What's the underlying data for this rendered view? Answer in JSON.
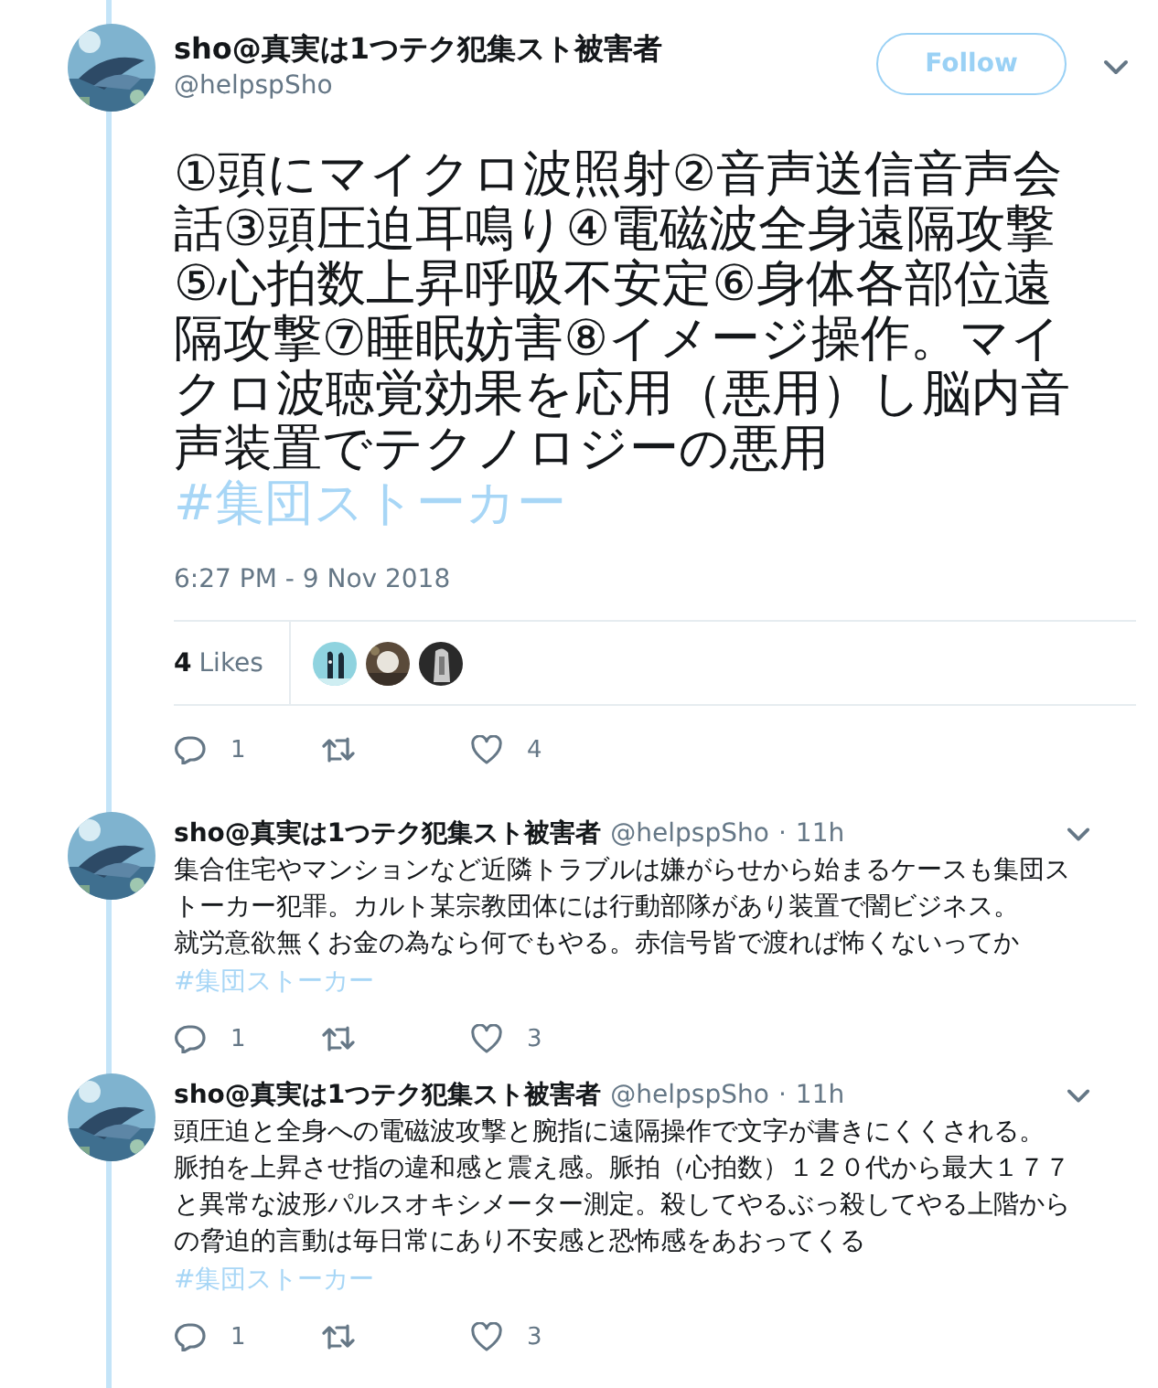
{
  "tweet": {
    "author": {
      "name": "sho@真実は1つテク犯集スト被害者",
      "handle": "@helpspSho"
    },
    "follow_button": "Follow",
    "text": "①頭にマイクロ波照射②音声送信音声会話③頭圧迫耳鳴り④電磁波全身遠隔攻撃⑤心拍数上昇呼吸不安定⑥身体各部位遠隔攻撃⑦睡眠妨害⑧イメージ操作。マイクロ波聴覚効果を応用（悪用）し脳内音声装置でテクノロジーの悪用",
    "hashtag": "#集団ストーカー",
    "timestamp": "6:27 PM - 9 Nov 2018",
    "likes": {
      "count": "4",
      "label": "Likes"
    },
    "actions": {
      "reply_count": "1",
      "like_count": "4"
    }
  },
  "replies": [
    {
      "name": "sho@真実は1つテク犯集スト被害者",
      "handle": "@helpspSho",
      "separator": "·",
      "time": "11h",
      "paragraphs": [
        "集合住宅やマンションなど近隣トラブルは嫌がらせから始まるケースも集団ストーカー犯罪。カルト某宗教団体には行動部隊があり装置で闇ビジネス。",
        "就労意欲無くお金の為なら何でもやる。赤信号皆で渡れば怖くないってか"
      ],
      "hashtag": "#集団ストーカー",
      "reply_count": "1",
      "like_count": "3"
    },
    {
      "name": "sho@真実は1つテク犯集スト被害者",
      "handle": "@helpspSho",
      "separator": "·",
      "time": "11h",
      "paragraphs": [
        "頭圧迫と全身への電磁波攻撃と腕指に遠隔操作で文字が書きにくくされる。",
        "脈拍を上昇させ指の違和感と震え感。脈拍（心拍数）１２０代から最大１７７と異常な波形パルスオキシメーター測定。殺してやるぶっ殺してやる上階からの脅迫的言動は毎日常にあり不安感と恐怖感をあおってくる"
      ],
      "hashtag": "#集団ストーカー",
      "reply_count": "1",
      "like_count": "3"
    }
  ]
}
